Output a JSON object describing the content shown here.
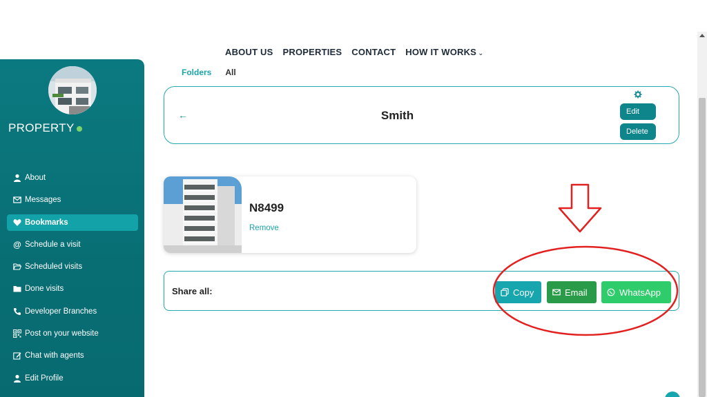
{
  "nav": {
    "items": [
      "ABOUT US",
      "PROPERTIES",
      "CONTACT",
      "HOW IT WORKS"
    ],
    "dropdown_icon": "chevron-down-icon"
  },
  "sidebar": {
    "brand": "PROPERTY",
    "brand_dot_color": "#7cd36a",
    "items": [
      {
        "label": "About",
        "icon": "user-icon"
      },
      {
        "label": "Messages",
        "icon": "envelope-icon"
      },
      {
        "label": "Bookmarks",
        "icon": "heart-icon",
        "active": true
      },
      {
        "label": "Schedule a visit",
        "icon": "at-icon"
      },
      {
        "label": "Scheduled visits",
        "icon": "folder-open-icon"
      },
      {
        "label": "Done visits",
        "icon": "folder-icon"
      },
      {
        "label": "Developer Branches",
        "icon": "phone-icon"
      },
      {
        "label": "Post on your website",
        "icon": "qr-icon"
      },
      {
        "label": "Chat with agents",
        "icon": "edit-icon"
      },
      {
        "label": "Edit Profile",
        "icon": "user-icon"
      }
    ]
  },
  "tabs": [
    "Folders",
    "All"
  ],
  "folder": {
    "title": "Smith",
    "edit_label": "Edit",
    "delete_label": "Delete"
  },
  "property": {
    "code": "N8499",
    "remove_label": "Remove"
  },
  "share": {
    "label": "Share all:",
    "copy_label": "Copy",
    "email_label": "Email",
    "whatsapp_label": "WhatsApp"
  },
  "colors": {
    "teal": "#0b7a80",
    "accent": "#1aa3a9",
    "email_green": "#2a9b48",
    "whatsapp_green": "#2ecc6a",
    "annotation_red": "#e32020"
  }
}
